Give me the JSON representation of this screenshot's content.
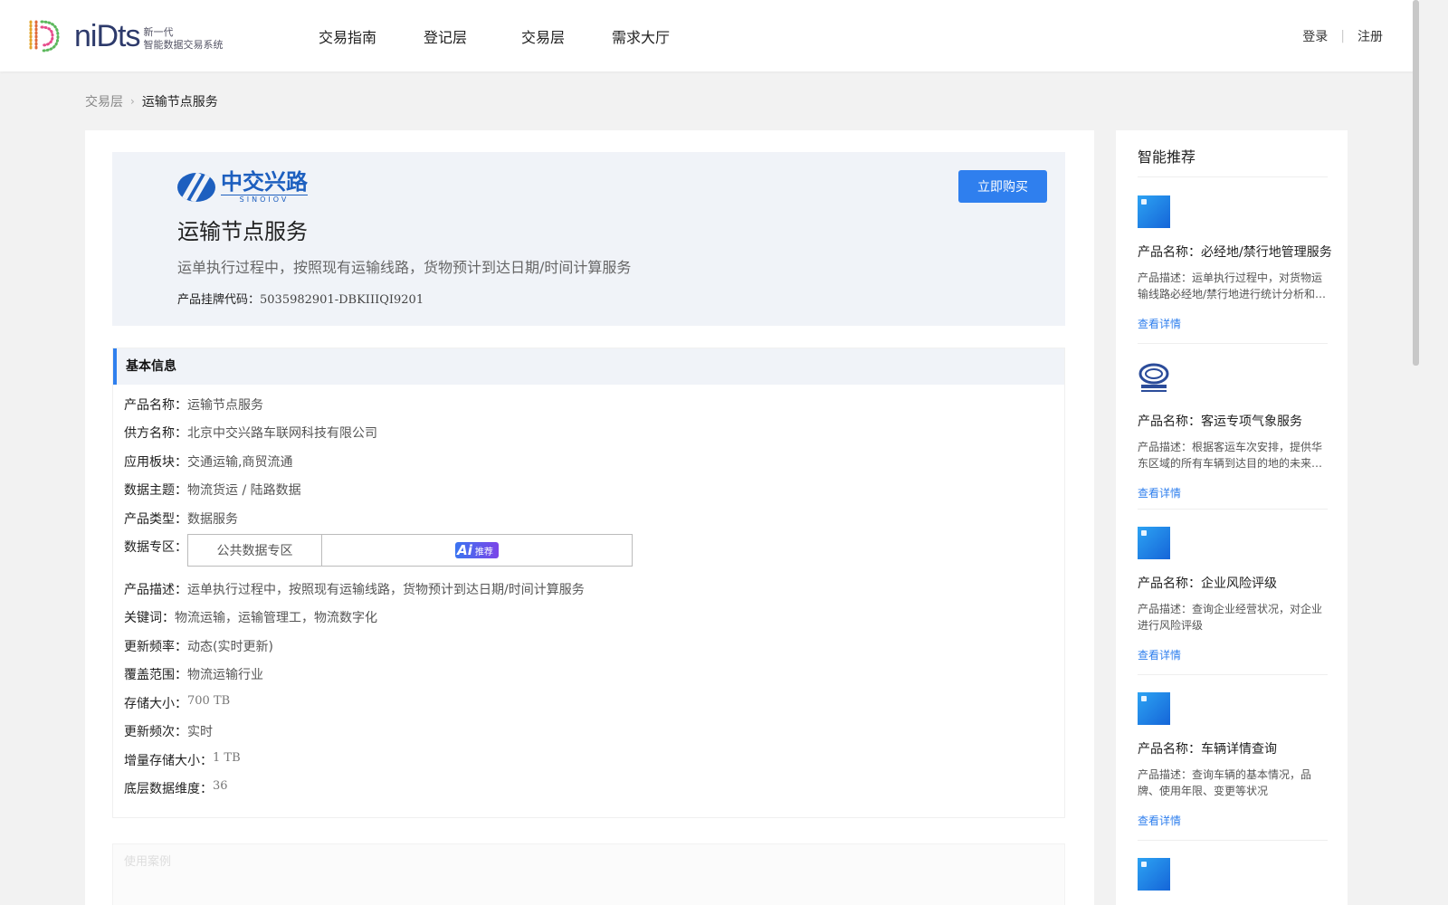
{
  "header": {
    "logo_word": "niDts",
    "logo_sub1": "新一代",
    "logo_sub2": "智能数据交易系统",
    "nav": [
      "交易指南",
      "登记层",
      "交易层",
      "需求大厅"
    ],
    "login": "登录",
    "register": "注册"
  },
  "breadcrumb": {
    "parent": "交易层",
    "current": "运输节点服务"
  },
  "hero": {
    "brand_cn": "中交兴路",
    "brand_en": "SINOIOV",
    "buy_label": "立即购买",
    "title": "运输节点服务",
    "desc": "运单执行过程中，按照现有运输线路，货物预计到达日期/时间计算服务",
    "code_label": "产品挂牌代码：",
    "code_value": "5035982901-DBKIIIQI9201"
  },
  "info": {
    "heading": "基本信息",
    "rows": [
      {
        "label": "产品名称：",
        "value": "运输节点服务"
      },
      {
        "label": "供方名称：",
        "value": "北京中交兴路车联网科技有限公司"
      },
      {
        "label": "应用板块：",
        "value": "交通运输,商贸流通"
      },
      {
        "label": "数据主题：",
        "value": "物流货运 / 陆路数据"
      },
      {
        "label": "产品类型：",
        "value": "数据服务"
      },
      {
        "label": "数据专区：",
        "zone": "公共数据专区",
        "ai_tag": "推荐",
        "ai_text": "Ai"
      },
      {
        "label": "产品描述：",
        "value": "运单执行过程中，按照现有运输线路，货物预计到达日期/时间计算服务"
      },
      {
        "label": "关键词：",
        "value": "物流运输，运输管理工，物流数字化"
      },
      {
        "label": "更新频率：",
        "value": "动态(实时更新)"
      },
      {
        "label": "覆盖范围：",
        "value": "物流运输行业"
      },
      {
        "label": "存储大小：",
        "value": "700 TB"
      },
      {
        "label": "更新频次：",
        "value": "实时"
      },
      {
        "label": "增量存储大小：",
        "value": "1 TB"
      },
      {
        "label": "底层数据维度：",
        "value": "36"
      }
    ]
  },
  "next_section": "使用案例",
  "sidebar": {
    "title": "智能推荐",
    "items": [
      {
        "name": "产品名称：必经地/禁行地管理服务",
        "desc": "产品描述：运单执行过程中，对货物运输线路必经地/禁行地进行统计分析和…",
        "link": "查看详情"
      },
      {
        "name": "产品名称：客运专项气象服务",
        "desc": "产品描述：根据客运车次安排，提供华东区域的所有车辆到达目的地的未来…",
        "link": "查看详情"
      },
      {
        "name": "产品名称：企业风险评级",
        "desc": "产品描述：查询企业经营状况，对企业进行风险评级",
        "link": "查看详情"
      },
      {
        "name": "产品名称：车辆详情查询",
        "desc": "产品描述：查询车辆的基本情况，品牌、使用年限、变更等状况",
        "link": "查看详情"
      }
    ]
  },
  "colors": {
    "accent": "#2f7fee",
    "brand": "#1d5fbf",
    "hero_bg": "#f0f3f8"
  }
}
